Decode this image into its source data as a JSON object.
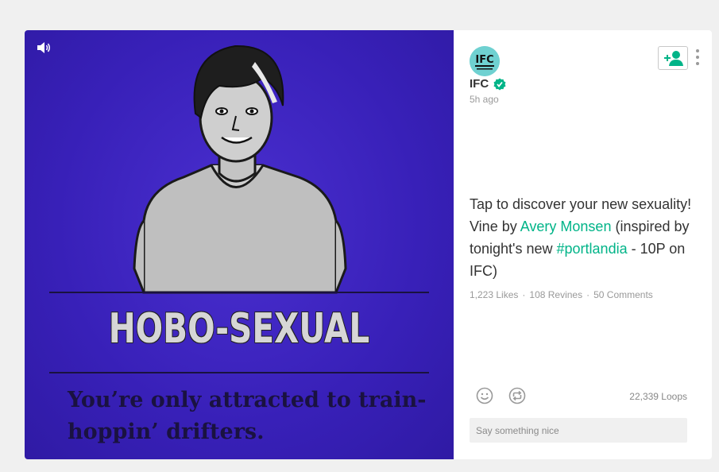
{
  "post": {
    "video": {
      "headline": "HOBO-SEXUAL",
      "subcaption": "You’re only attracted to train-hoppin’ drifters.",
      "sound_icon": "speaker-icon",
      "background_color": "#3820b8"
    },
    "author": {
      "avatar_text": "IFC",
      "name": "IFC",
      "verified_icon": "verified-badge-icon",
      "time_ago": "5h ago"
    },
    "follow_icon": "add-user-icon",
    "more_icon": "more-vertical-icon",
    "description": {
      "part1": "Tap to discover your new sexuality! Vine by ",
      "mention": "Avery Monsen",
      "part2": " (inspired by tonight's new ",
      "hashtag": "#portlandia",
      "part3": " - 10P on IFC)"
    },
    "stats": {
      "likes": "1,223 Likes",
      "revines": "108 Revines",
      "comments": "50 Comments"
    },
    "actions": {
      "smile_icon": "smiley-icon",
      "revine_icon": "revine-icon",
      "loops": "22,339 Loops"
    },
    "comment_input": {
      "placeholder": "Say something nice",
      "value": ""
    },
    "colors": {
      "accent": "#00b488",
      "video_bg": "#3820b8"
    }
  }
}
